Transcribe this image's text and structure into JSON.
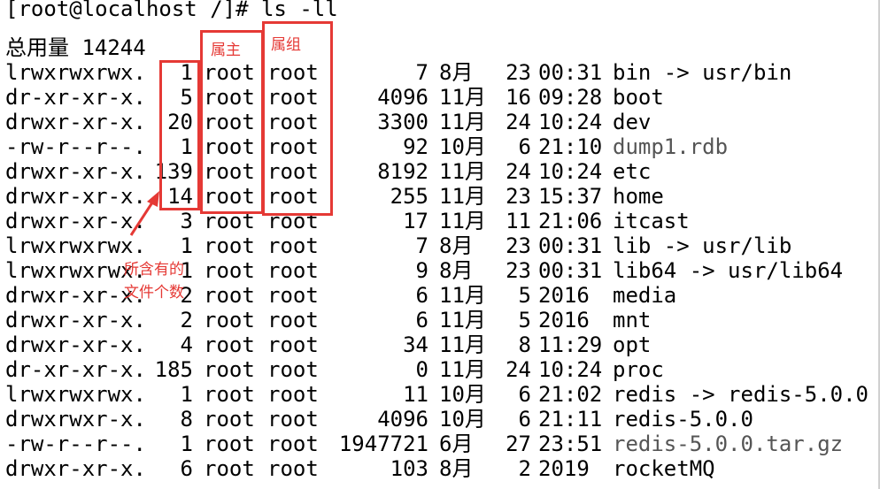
{
  "terminal": {
    "prompt": "[root@localhost /]# ls -ll",
    "total": "总用量 14244"
  },
  "rows": [
    {
      "perm": "lrwxrwxrwx.",
      "links": "1",
      "owner": "root",
      "group": "root",
      "size": "7",
      "month": "8月",
      "day": "23",
      "time": "00:31",
      "name": "bin -> usr/bin",
      "kind": "link"
    },
    {
      "perm": "dr-xr-xr-x.",
      "links": "5",
      "owner": "root",
      "group": "root",
      "size": "4096",
      "month": "11月",
      "day": "16",
      "time": "09:28",
      "name": "boot",
      "kind": "dir"
    },
    {
      "perm": "drwxr-xr-x.",
      "links": "20",
      "owner": "root",
      "group": "root",
      "size": "3300",
      "month": "11月",
      "day": "24",
      "time": "10:24",
      "name": "dev",
      "kind": "dir"
    },
    {
      "perm": "-rw-r--r--.",
      "links": "1",
      "owner": "root",
      "group": "root",
      "size": "92",
      "month": "10月",
      "day": "6",
      "time": "21:10",
      "name": "dump1.rdb",
      "kind": "file"
    },
    {
      "perm": "drwxr-xr-x.",
      "links": "139",
      "owner": "root",
      "group": "root",
      "size": "8192",
      "month": "11月",
      "day": "24",
      "time": "10:24",
      "name": "etc",
      "kind": "dir"
    },
    {
      "perm": "drwxr-xr-x.",
      "links": "14",
      "owner": "root",
      "group": "root",
      "size": "255",
      "month": "11月",
      "day": "23",
      "time": "15:37",
      "name": "home",
      "kind": "dir"
    },
    {
      "perm": "drwxr-xr-x.",
      "links": "3",
      "owner": "root",
      "group": "root",
      "size": "17",
      "month": "11月",
      "day": "11",
      "time": "21:06",
      "name": "itcast",
      "kind": "dir"
    },
    {
      "perm": "lrwxrwxrwx.",
      "links": "1",
      "owner": "root",
      "group": "root",
      "size": "7",
      "month": "8月",
      "day": "23",
      "time": "00:31",
      "name": "lib -> usr/lib",
      "kind": "link"
    },
    {
      "perm": "lrwxrwxrwx.",
      "links": "1",
      "owner": "root",
      "group": "root",
      "size": "9",
      "month": "8月",
      "day": "23",
      "time": "00:31",
      "name": "lib64 -> usr/lib64",
      "kind": "link"
    },
    {
      "perm": "drwxr-xr-x.",
      "links": "2",
      "owner": "root",
      "group": "root",
      "size": "6",
      "month": "11月",
      "day": "5",
      "time": "2016",
      "name": "media",
      "kind": "dir"
    },
    {
      "perm": "drwxr-xr-x.",
      "links": "2",
      "owner": "root",
      "group": "root",
      "size": "6",
      "month": "11月",
      "day": "5",
      "time": "2016",
      "name": "mnt",
      "kind": "dir"
    },
    {
      "perm": "drwxr-xr-x.",
      "links": "4",
      "owner": "root",
      "group": "root",
      "size": "34",
      "month": "11月",
      "day": "8",
      "time": "11:29",
      "name": "opt",
      "kind": "dir"
    },
    {
      "perm": "dr-xr-xr-x.",
      "links": "185",
      "owner": "root",
      "group": "root",
      "size": "0",
      "month": "11月",
      "day": "24",
      "time": "10:24",
      "name": "proc",
      "kind": "dir"
    },
    {
      "perm": "lrwxrwxrwx.",
      "links": "1",
      "owner": "root",
      "group": "root",
      "size": "11",
      "month": "10月",
      "day": "6",
      "time": "21:02",
      "name": "redis -> redis-5.0.0",
      "kind": "link"
    },
    {
      "perm": "drwxrwxr-x.",
      "links": "8",
      "owner": "root",
      "group": "root",
      "size": "4096",
      "month": "10月",
      "day": "6",
      "time": "21:11",
      "name": "redis-5.0.0",
      "kind": "dir"
    },
    {
      "perm": "-rw-r--r--.",
      "links": "1",
      "owner": "root",
      "group": "root",
      "size": "1947721",
      "month": "6月",
      "day": "27",
      "time": "23:51",
      "name": "redis-5.0.0.tar.gz",
      "kind": "file"
    },
    {
      "perm": "drwxr-xr-x.",
      "links": "6",
      "owner": "root",
      "group": "root",
      "size": "103",
      "month": "8月",
      "day": "2",
      "time": "2019",
      "name": "rocketMQ",
      "kind": "dir"
    }
  ],
  "annotations": {
    "owner_label": "属主",
    "group_label": "属组",
    "links_label_line1": "所含有的",
    "links_label_line2": "文件个数",
    "color": "#e53935"
  }
}
